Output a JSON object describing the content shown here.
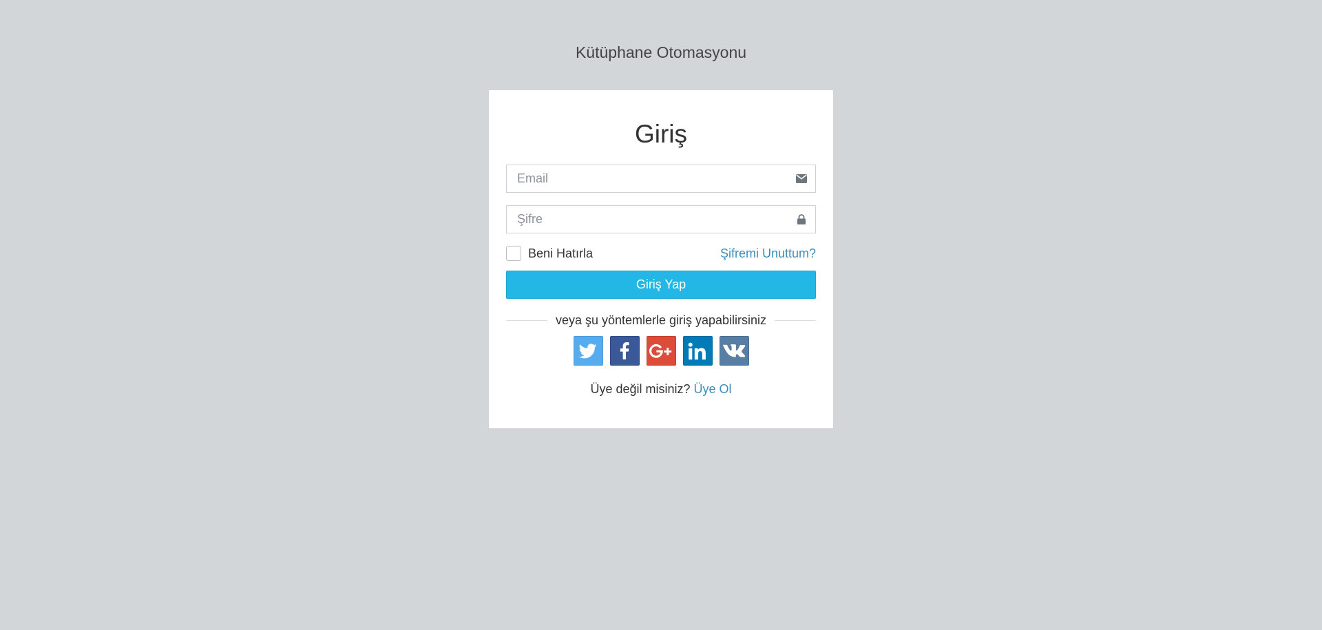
{
  "app": {
    "title": "Kütüphane Otomasyonu"
  },
  "login": {
    "heading": "Giriş",
    "email": {
      "placeholder": "Email",
      "value": "",
      "icon": "envelope-icon"
    },
    "password": {
      "placeholder": "Şifre",
      "value": "",
      "icon": "lock-icon"
    },
    "remember_label": "Beni Hatırla",
    "remember_checked": false,
    "forgot_label": "Şifremi Unuttum?",
    "submit_label": "Giriş Yap",
    "social_divider": "veya şu yöntemlerle giriş yapabilirsiniz",
    "social": [
      {
        "name": "twitter",
        "icon": "twitter-icon",
        "color": "#55acee"
      },
      {
        "name": "facebook",
        "icon": "facebook-icon",
        "color": "#3b5998"
      },
      {
        "name": "google-plus",
        "icon": "google-plus-icon",
        "color": "#dd4b39"
      },
      {
        "name": "linkedin",
        "icon": "linkedin-icon",
        "color": "#007bb6"
      },
      {
        "name": "vk",
        "icon": "vk-icon",
        "color": "#587ea3"
      }
    ],
    "signup_prompt": "Üye değil misiniz?",
    "signup_label": "Üye Ol"
  },
  "colors": {
    "background": "#d2d6d9",
    "card": "#ffffff",
    "primary_button": "#23b7e5",
    "link": "#3c8dbc"
  }
}
